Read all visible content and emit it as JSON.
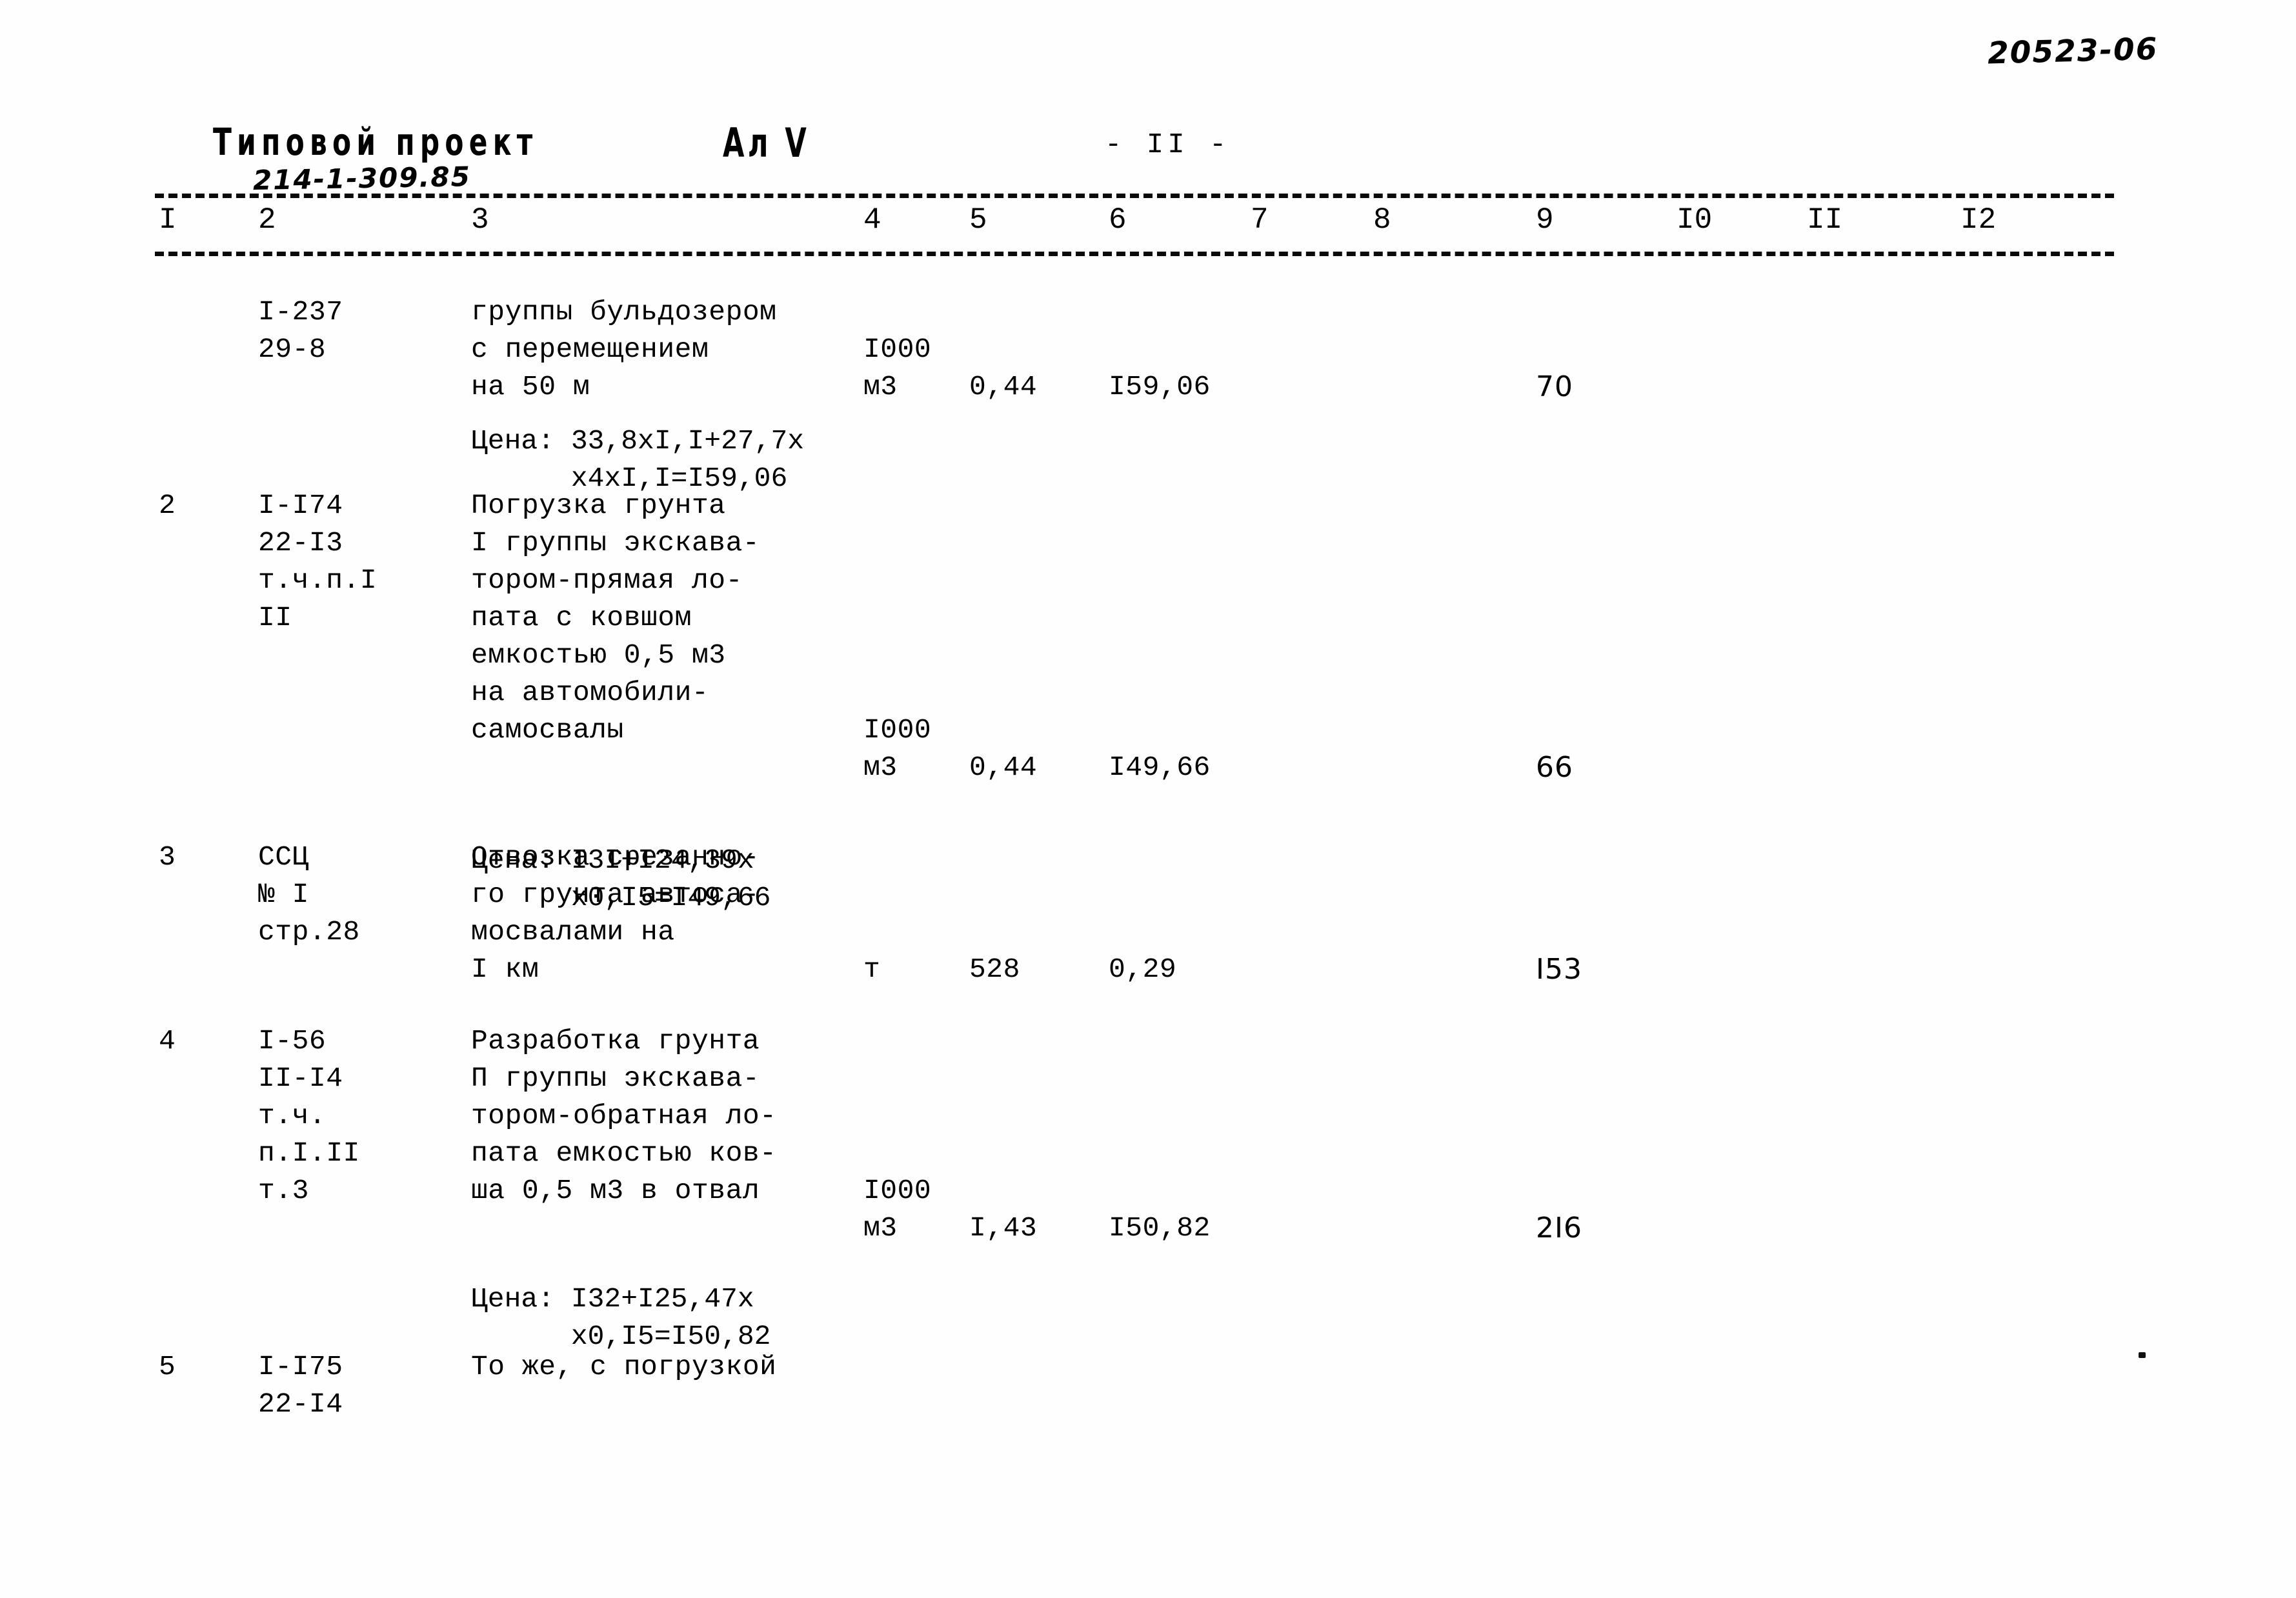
{
  "document": {
    "doc_code": "20523-06",
    "project_label": "Типовой проект",
    "project_number": "214-1-309.85",
    "album_label": "Ал V",
    "page_number": "- II -"
  },
  "table": {
    "column_headers": [
      "I",
      "2",
      "3",
      "4",
      "5",
      "6",
      "7",
      "8",
      "9",
      "I0",
      "II",
      "I2"
    ],
    "rows": [
      {
        "no": "",
        "code": "I-237\n29-8",
        "description": "группы бульдозером\nс перемещением\nна 50 м",
        "unit": "I000\nм3",
        "qty": "0,44",
        "price": "I59,06",
        "col7": "",
        "col8": "",
        "col9": "70",
        "col10": "",
        "col11": "",
        "col12": "",
        "formula": "Цена: 33,8xI,I+27,7x\n      x4xI,I=I59,06"
      },
      {
        "no": "2",
        "code": "I-I74\n22-I3\nт.ч.п.I\nII",
        "description": "Погрузка грунта\nI группы экскава-\nтором-прямая ло-\nпата с ковшом\nемкостью 0,5 м3\nна автомобили-\nсамосвалы",
        "unit": "I000\nм3",
        "qty": "0,44",
        "price": "I49,66",
        "col7": "",
        "col8": "",
        "col9": "66",
        "col10": "",
        "col11": "",
        "col12": "",
        "formula": "Цена: I3I+I24,39x\n      x0,I5=I49,66"
      },
      {
        "no": "3",
        "code": "ССЦ\n№ I\nстр.28",
        "description": "Отвозка срезанно-\nго грунта автоса-\nмосвалами на\nI км",
        "unit": "т",
        "qty": "528",
        "price": "0,29",
        "col7": "",
        "col8": "",
        "col9": "I53",
        "col10": "",
        "col11": "",
        "col12": "",
        "formula": ""
      },
      {
        "no": "4",
        "code": "I-56\nII-I4\nт.ч.\nп.I.II\nт.3",
        "description": "Разработка грунта\nП группы экскава-\nтором-обратная ло-\nпата емкостью ков-\nша 0,5 м3 в отвал",
        "unit": "I000\nм3",
        "qty": "I,43",
        "price": "I50,82",
        "col7": "",
        "col8": "",
        "col9": "2I6",
        "col10": "",
        "col11": "",
        "col12": "",
        "formula": "Цена: I32+I25,47x\n      x0,I5=I50,82"
      },
      {
        "no": "5",
        "code": "I-I75\n22-I4",
        "description": "То же, с погрузкой",
        "unit": "",
        "qty": "",
        "price": "",
        "col7": "",
        "col8": "",
        "col9": "",
        "col10": "",
        "col11": "",
        "col12": "",
        "formula": ""
      }
    ]
  },
  "colors": {
    "ink": "#000000",
    "paper": "#fefefe"
  }
}
